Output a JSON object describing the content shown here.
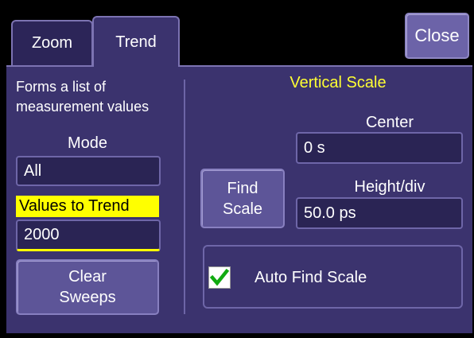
{
  "tabs": [
    {
      "label": "Zoom"
    },
    {
      "label": "Trend"
    }
  ],
  "close_label": "Close",
  "description": {
    "line1": "Forms a list of",
    "line2": "measurement values"
  },
  "mode": {
    "label": "Mode",
    "value": "All"
  },
  "values_to_trend": {
    "label": "Values to Trend",
    "value": "2000",
    "highlight_color": "#ffff00"
  },
  "clear_sweeps": {
    "line1": "Clear",
    "line2": "Sweeps"
  },
  "vertical_scale": {
    "title": "Vertical Scale",
    "title_color": "#ffff33",
    "center_label": "Center",
    "center_value": "0 s",
    "height_label": "Height/div",
    "height_value": "50.0 ps",
    "find_scale_line1": "Find",
    "find_scale_line2": "Scale",
    "auto_find_label": "Auto Find Scale",
    "auto_find_checked": true,
    "check_color": "#11aa11"
  }
}
